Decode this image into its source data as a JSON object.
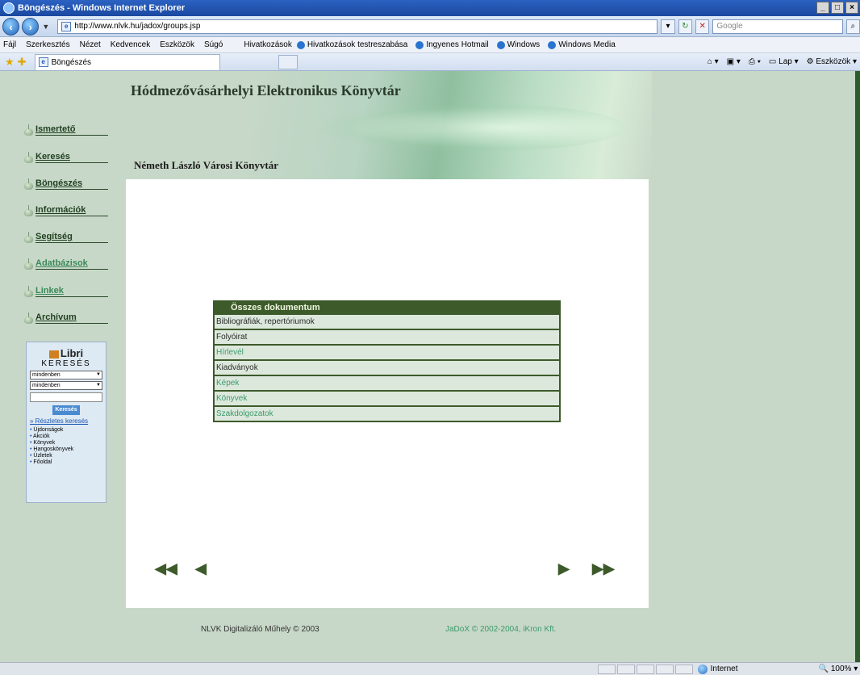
{
  "window": {
    "title": "Böngészés - Windows Internet Explorer",
    "controls": [
      "_",
      "□",
      "×"
    ]
  },
  "addressbar": {
    "url": "http://www.nlvk.hu/jadox/groups.jsp",
    "search_placeholder": "Google"
  },
  "menubar": {
    "menus": [
      "Fájl",
      "Szerkesztés",
      "Nézet",
      "Kedvencek",
      "Eszközök",
      "Súgó"
    ],
    "links_label": "Hivatkozások",
    "favorites": [
      "Hivatkozások testreszabása",
      "Ingyenes Hotmail",
      "Windows",
      "Windows Media"
    ]
  },
  "tabbar": {
    "tab_title": "Böngészés",
    "tools": [
      "Lap",
      "Eszközök"
    ]
  },
  "banner": {
    "title": "Hódmezővásárhelyi Elektronikus Könyvtár",
    "subtitle": "Németh László Városi Könyvtár"
  },
  "sidebar": {
    "items": [
      {
        "label": "Ismertető"
      },
      {
        "label": "Keresés"
      },
      {
        "label": "Böngészés"
      },
      {
        "label": "Információk"
      },
      {
        "label": "Segítség"
      },
      {
        "label": "Adatbázisok"
      },
      {
        "label": "Linkek"
      },
      {
        "label": "Archívum"
      }
    ]
  },
  "libri": {
    "logo": "Libri",
    "heading": "KERESÉS",
    "select1": "mindenben",
    "select2": "mindenben",
    "button": "Keresés",
    "advanced": "Részletes keresés",
    "links": [
      "Újdonságok",
      "Akciók",
      "Könyvek",
      "Hangoskönyvek",
      "Üzletek",
      "Főoldal"
    ]
  },
  "groups": {
    "header": "Összes dokumentum",
    "rows": [
      "Bibliográfiák, repertóriumok",
      "Folyóirat",
      "Hírlevél",
      "Kiadványok",
      "Képek",
      "Könyvek",
      "Szakdolgozatok"
    ]
  },
  "pager": {
    "first": "◀◀",
    "prev": "◀",
    "next": "▶",
    "last": "▶▶"
  },
  "footer": {
    "left": "NLVK Digitalizáló Műhely © 2003",
    "right": "JaDoX © 2002-2004, iKron Kft."
  },
  "statusbar": {
    "zone": "Internet",
    "zoom": "100%"
  },
  "colors": {
    "page_bg": "#c8d8c8",
    "group_border": "#3d5a2a",
    "link_green": "#3a9a6a"
  }
}
